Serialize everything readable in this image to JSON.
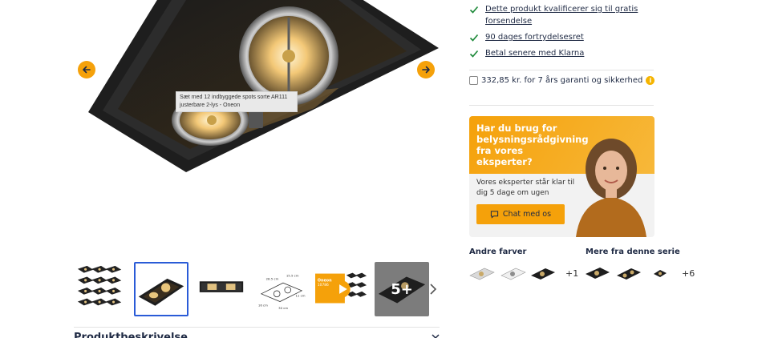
{
  "gallery": {
    "main_image_alt": "Sæt med 12 indbyggede spots sorte AR111 justerbare 2-lys - Oneon",
    "tooltip": "Sæt med 12 indbyggede spots sorte AR111 justerbare 2-lys - Oneon",
    "thumbnails": [
      {
        "name": "thumb-set-grid",
        "active": false
      },
      {
        "name": "thumb-black-spot",
        "active": true
      },
      {
        "name": "thumb-side-view",
        "active": false
      },
      {
        "name": "thumb-dimensions",
        "active": false
      },
      {
        "name": "thumb-video",
        "active": false
      },
      {
        "name": "thumb-more",
        "active": false
      }
    ],
    "video_badge": "Oneon 10786",
    "dim_labels": [
      "28.5 cm",
      "15.5 cm",
      "11 cm",
      "16 cm",
      "30 cm"
    ],
    "more_label": "5+"
  },
  "description": {
    "heading": "Produktbeskrivelse"
  },
  "usps": [
    "Dette produkt kvalificerer sig til gratis forsendelse",
    "90 dages fortrydelsesret",
    "Betal senere med Klarna"
  ],
  "guarantee": {
    "label": "332,85 kr. for 7 års garanti og sikkerhed",
    "info_icon": "i"
  },
  "advice": {
    "title": "Har du brug for belysningsrådgivning fra vores eksperter?",
    "text": "Vores eksperter står klar til dig 5 dage om ugen",
    "button": "Chat med os"
  },
  "other_colors": {
    "label": "Andre farver",
    "more": "+1"
  },
  "same_series": {
    "label": "Mere fra denne serie",
    "more": "+6"
  },
  "colors": {
    "accent": "#f5a10a",
    "text": "#1f2a44",
    "check": "#1f8a3b",
    "active_border": "#2a5bd7"
  }
}
